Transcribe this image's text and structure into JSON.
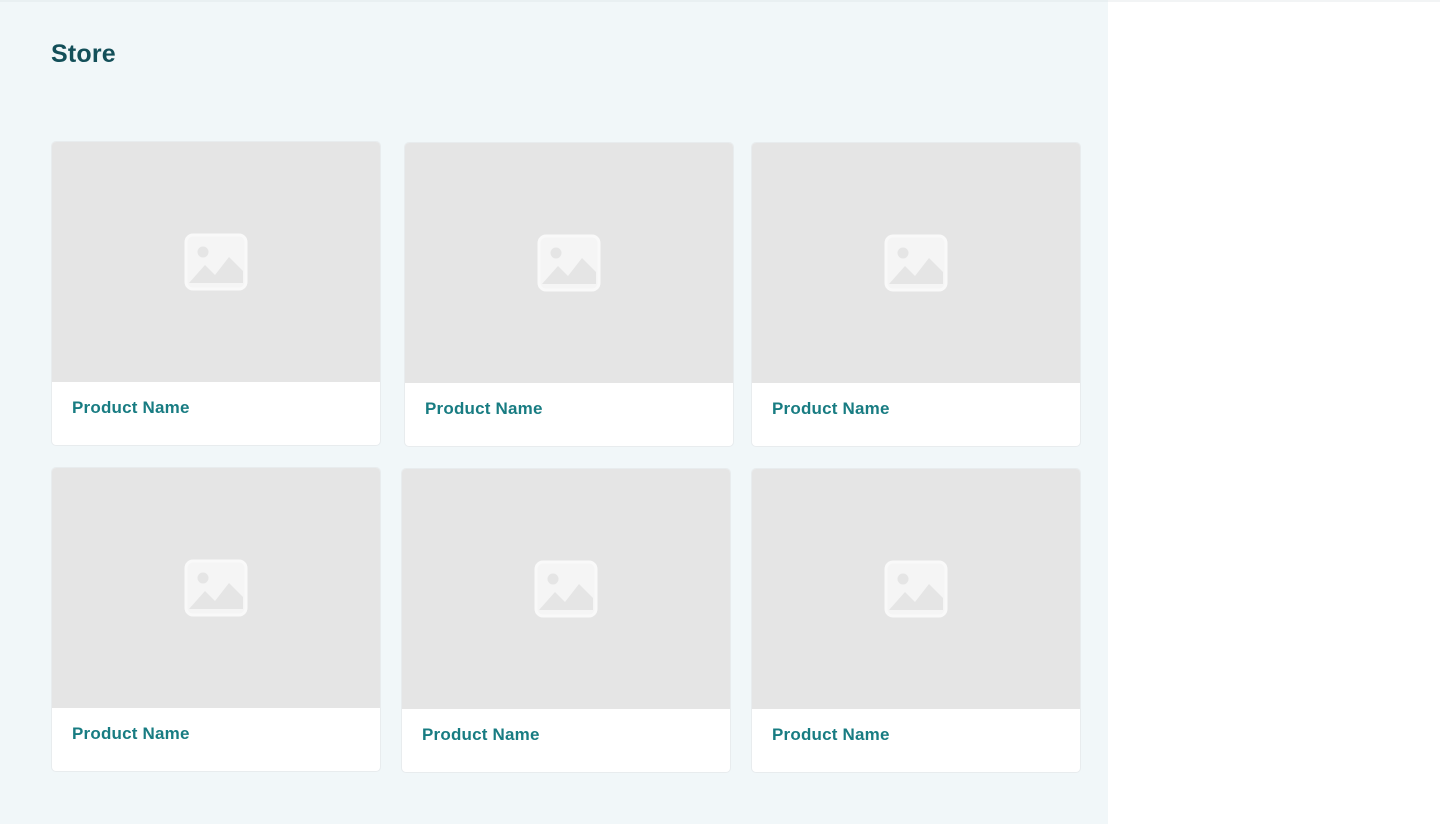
{
  "page": {
    "title": "Store"
  },
  "colors": {
    "main_background": "#f1f7f9",
    "title_color": "#134f59",
    "product_name_color": "#187c82",
    "image_placeholder": "#e5e5e5",
    "card_background": "#ffffff"
  },
  "products": [
    {
      "name": "Product Name",
      "image_icon": "image-placeholder-icon"
    },
    {
      "name": "Product Name",
      "image_icon": "image-placeholder-icon"
    },
    {
      "name": "Product Name",
      "image_icon": "image-placeholder-icon"
    },
    {
      "name": "Product Name",
      "image_icon": "image-placeholder-icon"
    },
    {
      "name": "Product Name",
      "image_icon": "image-placeholder-icon"
    },
    {
      "name": "Product Name",
      "image_icon": "image-placeholder-icon"
    }
  ]
}
